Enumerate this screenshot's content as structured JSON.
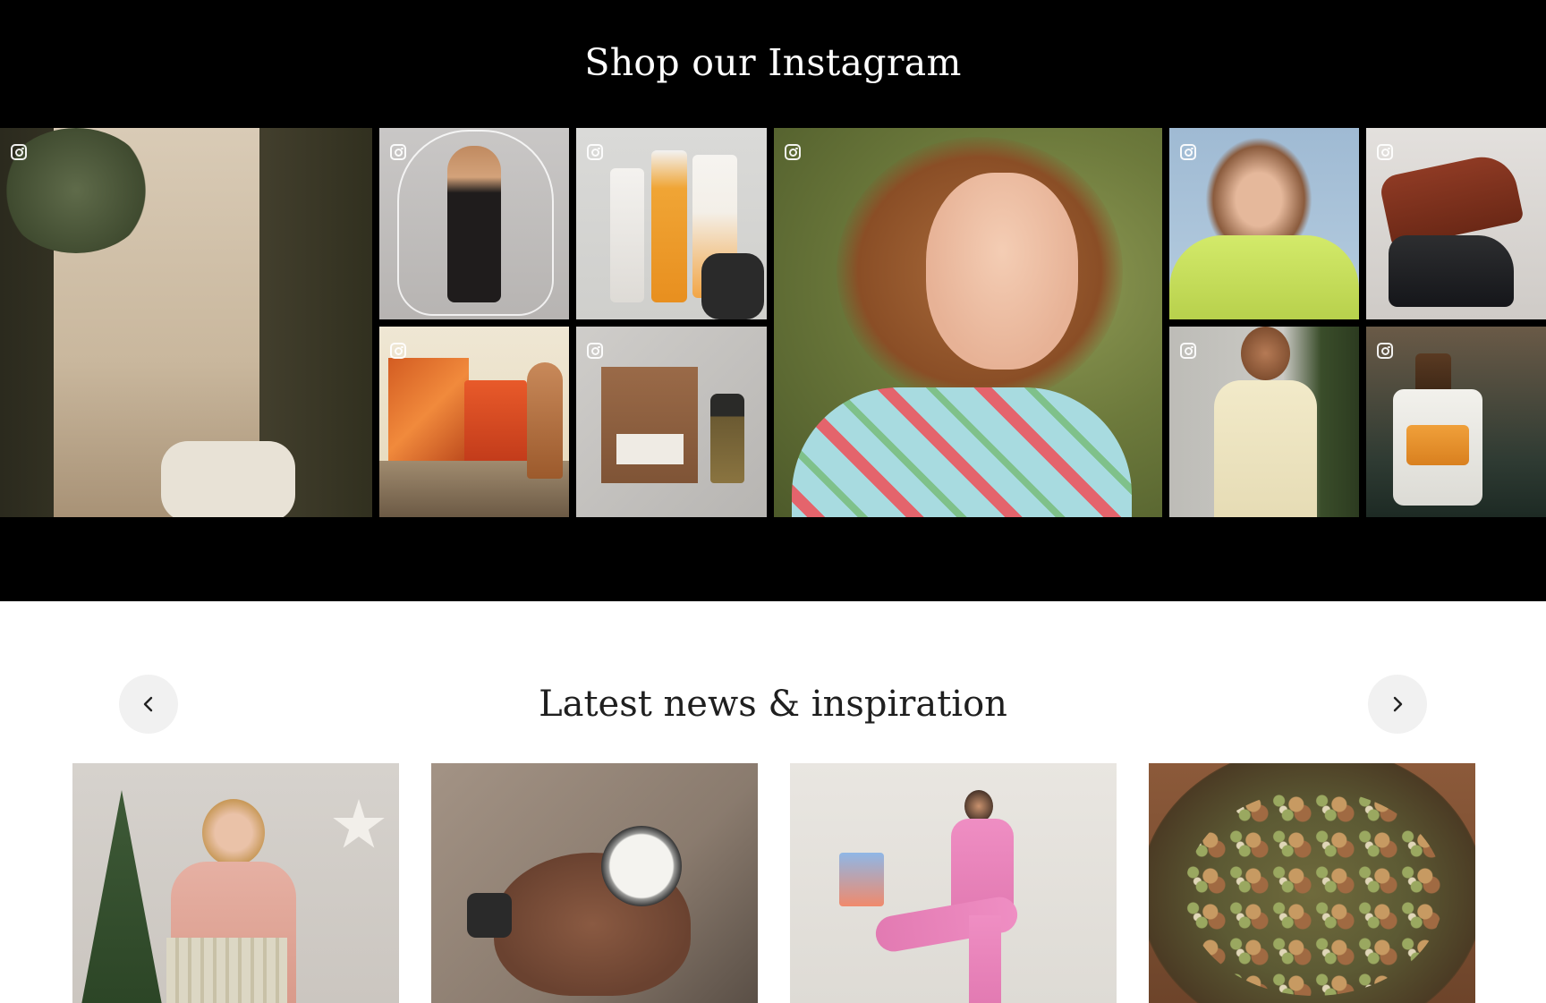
{
  "instagram": {
    "title": "Shop our Instagram",
    "icon": "instagram-icon",
    "tiles": [
      {
        "name": "post-sandals"
      },
      {
        "name": "post-black-dress"
      },
      {
        "name": "post-hair-products"
      },
      {
        "name": "post-girl-portrait"
      },
      {
        "name": "post-green-knit"
      },
      {
        "name": "post-leather-boots"
      },
      {
        "name": "post-candles"
      },
      {
        "name": "post-le-labo"
      },
      {
        "name": "post-man-polo"
      },
      {
        "name": "post-proraso"
      }
    ]
  },
  "news": {
    "title": "Latest news & inspiration",
    "prev_icon": "chevron-left-icon",
    "next_icon": "chevron-right-icon",
    "cards": [
      {
        "name": "article-christmas-gifts"
      },
      {
        "name": "article-skincare-balm"
      },
      {
        "name": "article-pink-suit"
      },
      {
        "name": "article-trail-mix"
      }
    ]
  },
  "colors": {
    "section_bg": "#000000",
    "page_bg": "#ffffff",
    "heading_light": "#ffffff",
    "heading_dark": "#1f1f1f",
    "nav_bg": "#f1f1f1"
  }
}
